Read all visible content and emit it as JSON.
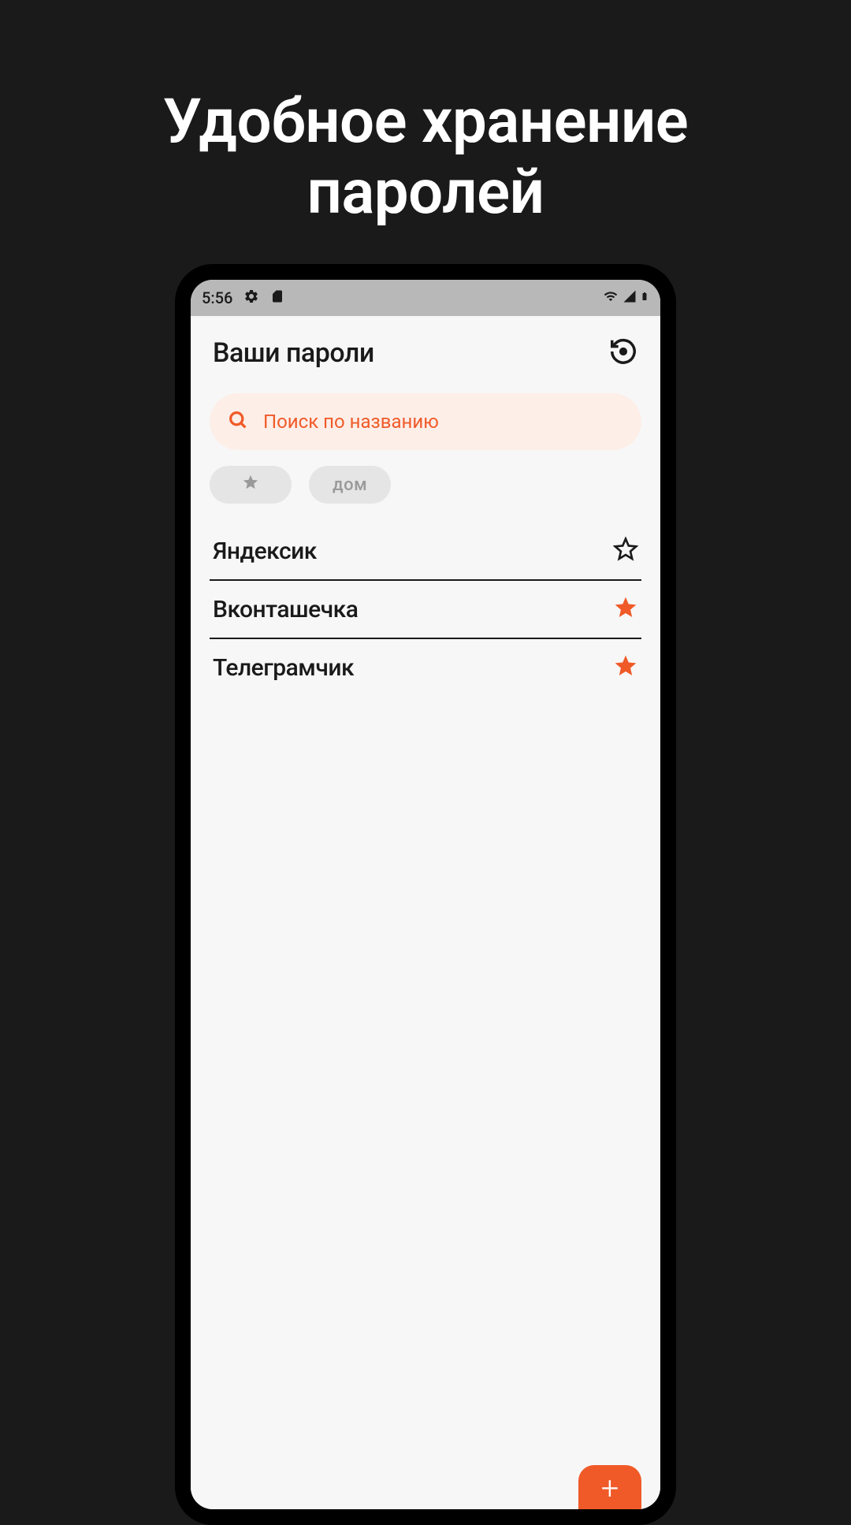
{
  "promo": {
    "title": "Удобное хранение паролей"
  },
  "statusBar": {
    "time": "5:56"
  },
  "header": {
    "title": "Ваши пароли"
  },
  "search": {
    "placeholder": "Поиск по названию"
  },
  "chips": {
    "items": [
      {
        "label": "★",
        "type": "star"
      },
      {
        "label": "дом",
        "type": "text"
      }
    ]
  },
  "passwords": {
    "items": [
      {
        "name": "Яндексик",
        "starred": false
      },
      {
        "name": "Вконташечка",
        "starred": true
      },
      {
        "name": "Телеграмчик",
        "starred": true
      }
    ]
  },
  "colors": {
    "accent": "#f05a28",
    "background": "#1a1a1a",
    "appBg": "#f7f7f7"
  }
}
